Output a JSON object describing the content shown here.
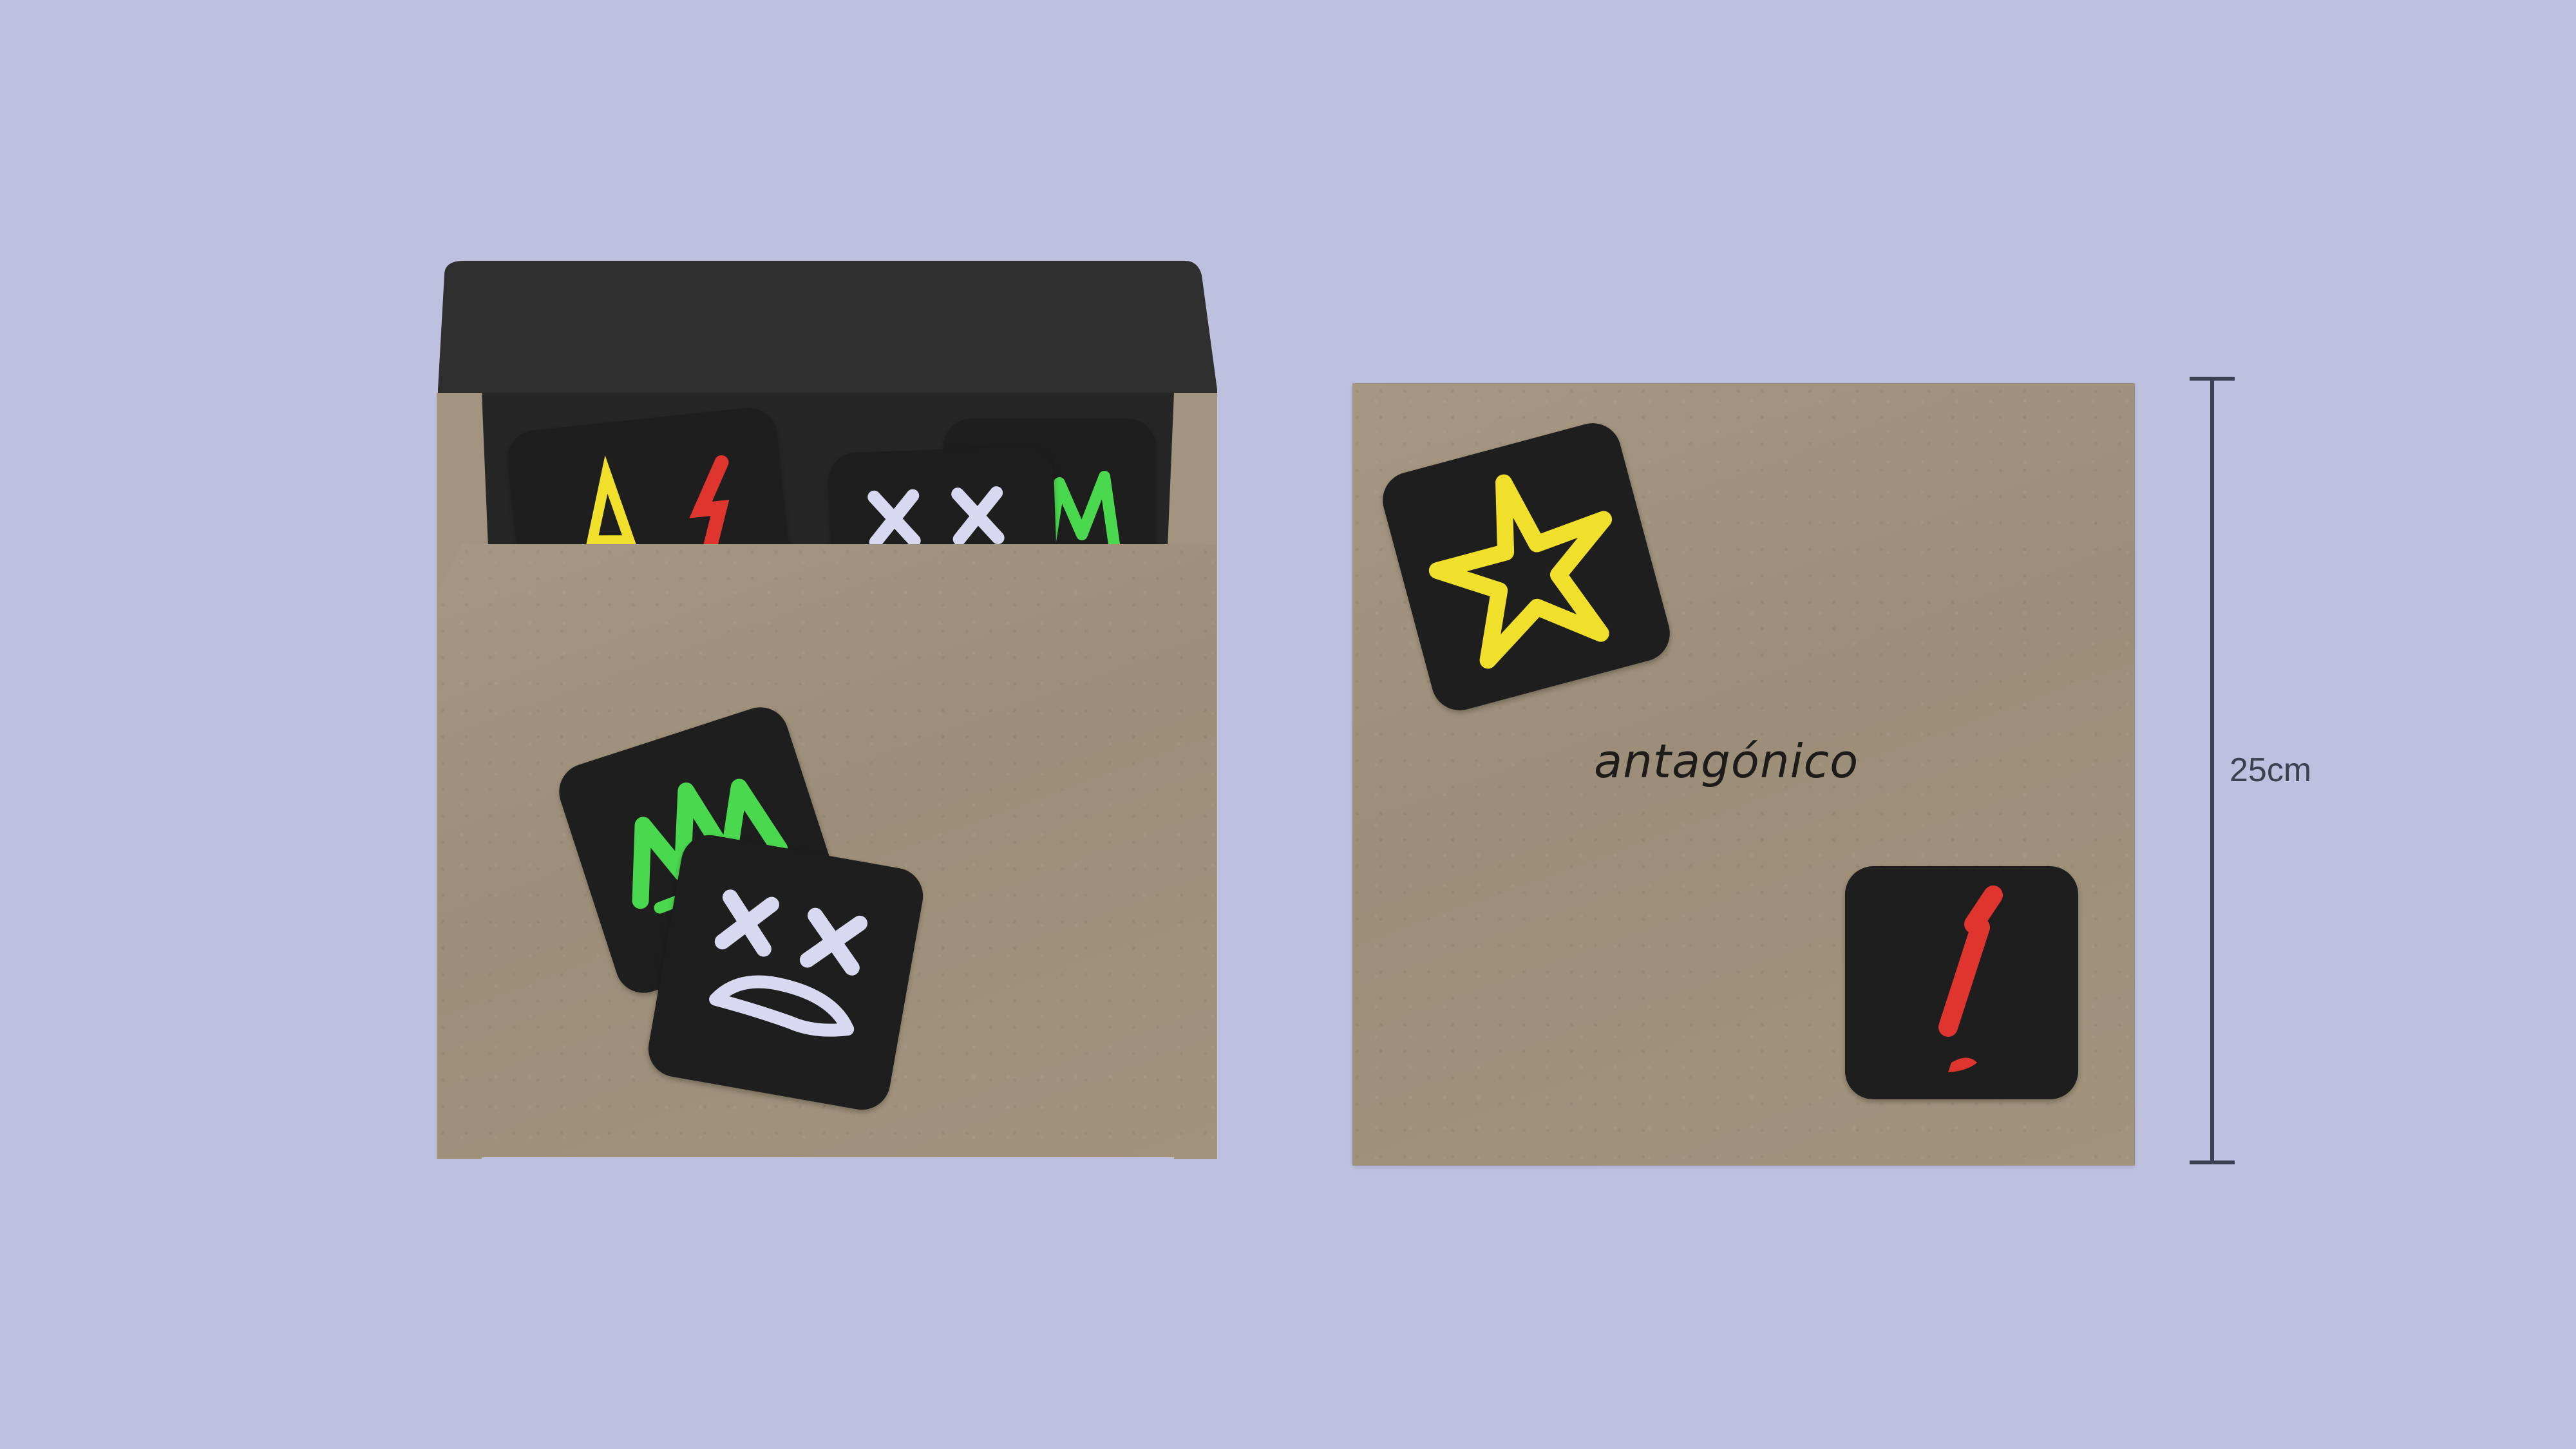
{
  "mockup": {
    "brand_name": "antagónico",
    "dimension_label": "25cm"
  },
  "stickers": {
    "icons": [
      "crown-icon",
      "star-icon",
      "exclamation-icon",
      "dizzy-face-icon"
    ],
    "colors": {
      "crown": "#4ad84e",
      "star": "#f0e02b",
      "exclamation": "#e0352f",
      "face": "#d8d8f0",
      "sticker_background": "#1f1e1e"
    }
  },
  "palette": {
    "background": "#bec0e0",
    "kraft": "#a0927c",
    "envelope_interior": "#2e2e2e",
    "measure_line": "#3d3f52"
  }
}
